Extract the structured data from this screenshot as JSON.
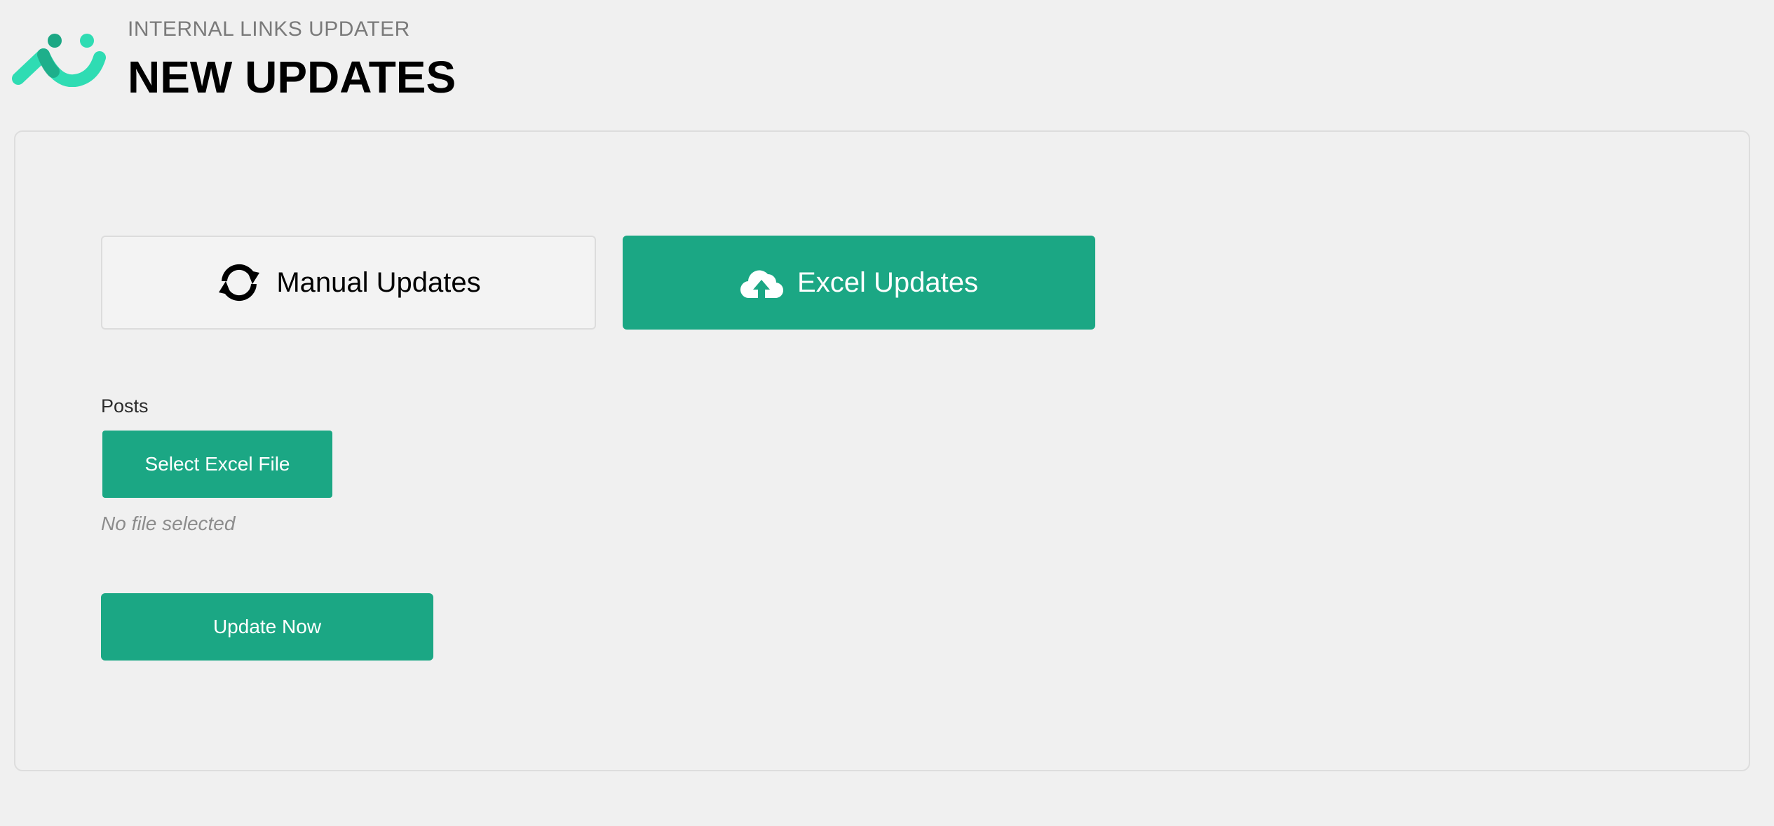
{
  "header": {
    "eyebrow": "INTERNAL LINKS UPDATER",
    "title": "NEW UPDATES",
    "logo_icon": "smile-logo-icon"
  },
  "tabs": [
    {
      "label": "Manual Updates",
      "icon": "sync-icon",
      "active": false
    },
    {
      "label": "Excel Updates",
      "icon": "cloud-upload-icon",
      "active": true
    }
  ],
  "form": {
    "posts_label": "Posts",
    "select_button_label": "Select Excel File",
    "file_status": "No file selected",
    "submit_label": "Update Now"
  },
  "colors": {
    "accent": "#1ba784",
    "logo_light": "#2fdcb3",
    "logo_dark": "#1ba784",
    "background": "#f0f0f0"
  }
}
